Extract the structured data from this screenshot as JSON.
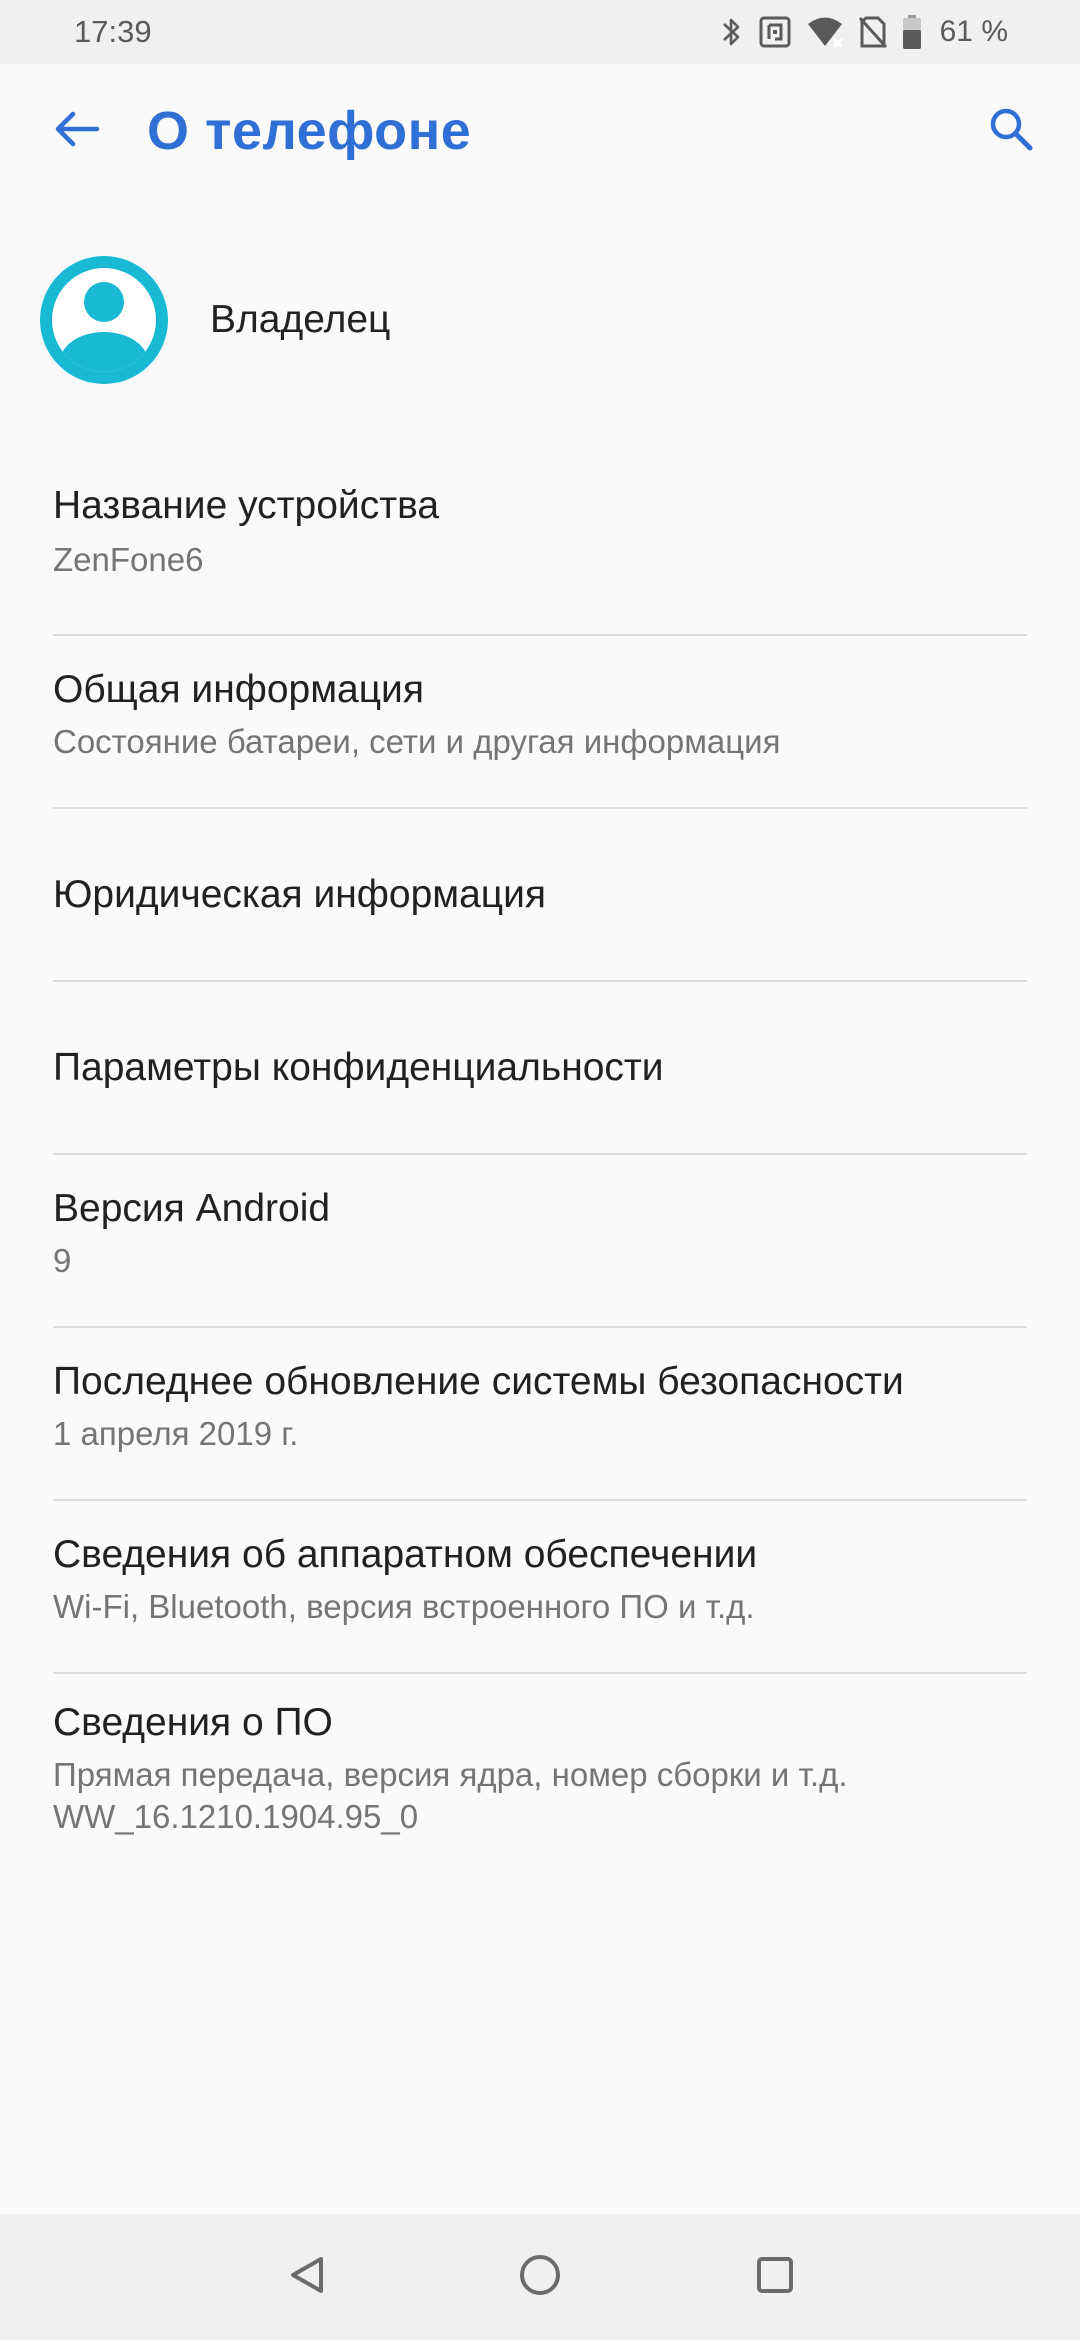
{
  "status_bar": {
    "time": "17:39",
    "battery_percent": "61 %",
    "icons": [
      "bluetooth-icon",
      "nfc-icon",
      "wifi-icon",
      "no-sim-icon",
      "battery-icon"
    ]
  },
  "app_bar": {
    "title": "О телефоне",
    "back_icon": "arrow-back-icon",
    "search_icon": "search-icon"
  },
  "owner": {
    "name": "Владелец",
    "avatar_color": "#19b9d6"
  },
  "settings": {
    "device_name": {
      "title": "Название устройства",
      "value": "ZenFone6"
    },
    "general_info": {
      "title": "Общая информация",
      "subtitle": "Состояние батареи, сети и другая информация"
    },
    "legal_info": {
      "title": "Юридическая информация"
    },
    "privacy": {
      "title": "Параметры конфиденциальности"
    },
    "android_version": {
      "title": "Версия Android",
      "value": "9"
    },
    "security_update": {
      "title": "Последнее обновление системы безопасности",
      "value": "1 апреля 2019 г."
    },
    "hardware_info": {
      "title": "Сведения об аппаратном обеспечении",
      "subtitle": "Wi-Fi, Bluetooth, версия встроенного ПО и т.д."
    },
    "software_info": {
      "title": "Сведения о ПО",
      "subtitle": "Прямая передача, версия ядра, номер сборки и т.д.",
      "build": "WW_16.1210.1904.95_0"
    }
  },
  "nav_bar": {
    "icons": [
      "nav-back-icon",
      "nav-home-icon",
      "nav-recents-icon"
    ]
  },
  "colors": {
    "accent": "#2f6fd6",
    "background": "#fafafa",
    "divider": "#dcdcdc"
  }
}
